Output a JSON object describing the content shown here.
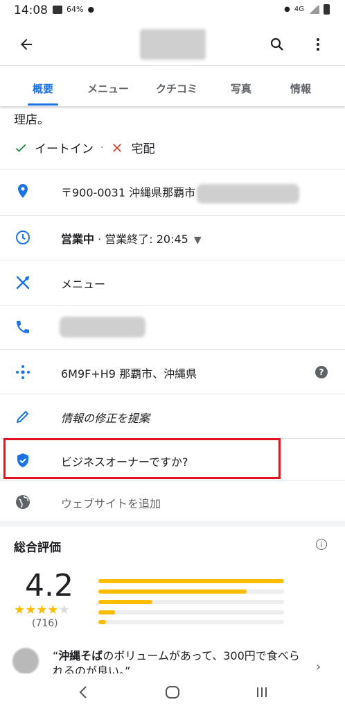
{
  "status_bar": {
    "time": "14:08",
    "battery_percent": "64%",
    "network": "4G"
  },
  "app_bar": {
    "back_icon": "arrow-left-icon",
    "search_icon": "search-icon",
    "more_icon": "more-vert-icon"
  },
  "tabs": [
    {
      "label": "概要",
      "active": true
    },
    {
      "label": "メニュー",
      "active": false
    },
    {
      "label": "クチコミ",
      "active": false
    },
    {
      "label": "写真",
      "active": false
    },
    {
      "label": "情報",
      "active": false
    }
  ],
  "description_tail": "理店。",
  "services": {
    "dine_in": "イートイン",
    "separator": "·",
    "delivery": "宅配"
  },
  "info": {
    "address": "〒900-0031 沖縄県那覇市",
    "hours_status": "営業中",
    "hours_detail": " · 営業終了: 20:45",
    "menu": "メニュー",
    "plus_code": "6M9F+H9 那覇市、沖縄県",
    "suggest_edit": "情報の修正を提案",
    "claim_business": "ビジネスオーナーですか?",
    "add_website": "ウェブサイトを追加"
  },
  "rating": {
    "title": "総合評価",
    "score": "4.2",
    "stars": 4,
    "review_count": "(716)",
    "distribution": [
      1.0,
      0.8,
      0.29,
      0.09,
      0.04
    ]
  },
  "review": {
    "highlight": "沖縄そば",
    "text": "“沖縄そばのボリュームがあって、300円で食べられるのが良い。”"
  },
  "colors": {
    "accent": "#1a73e8",
    "highlight_border": "#e0141e",
    "star": "#fbbc04"
  }
}
